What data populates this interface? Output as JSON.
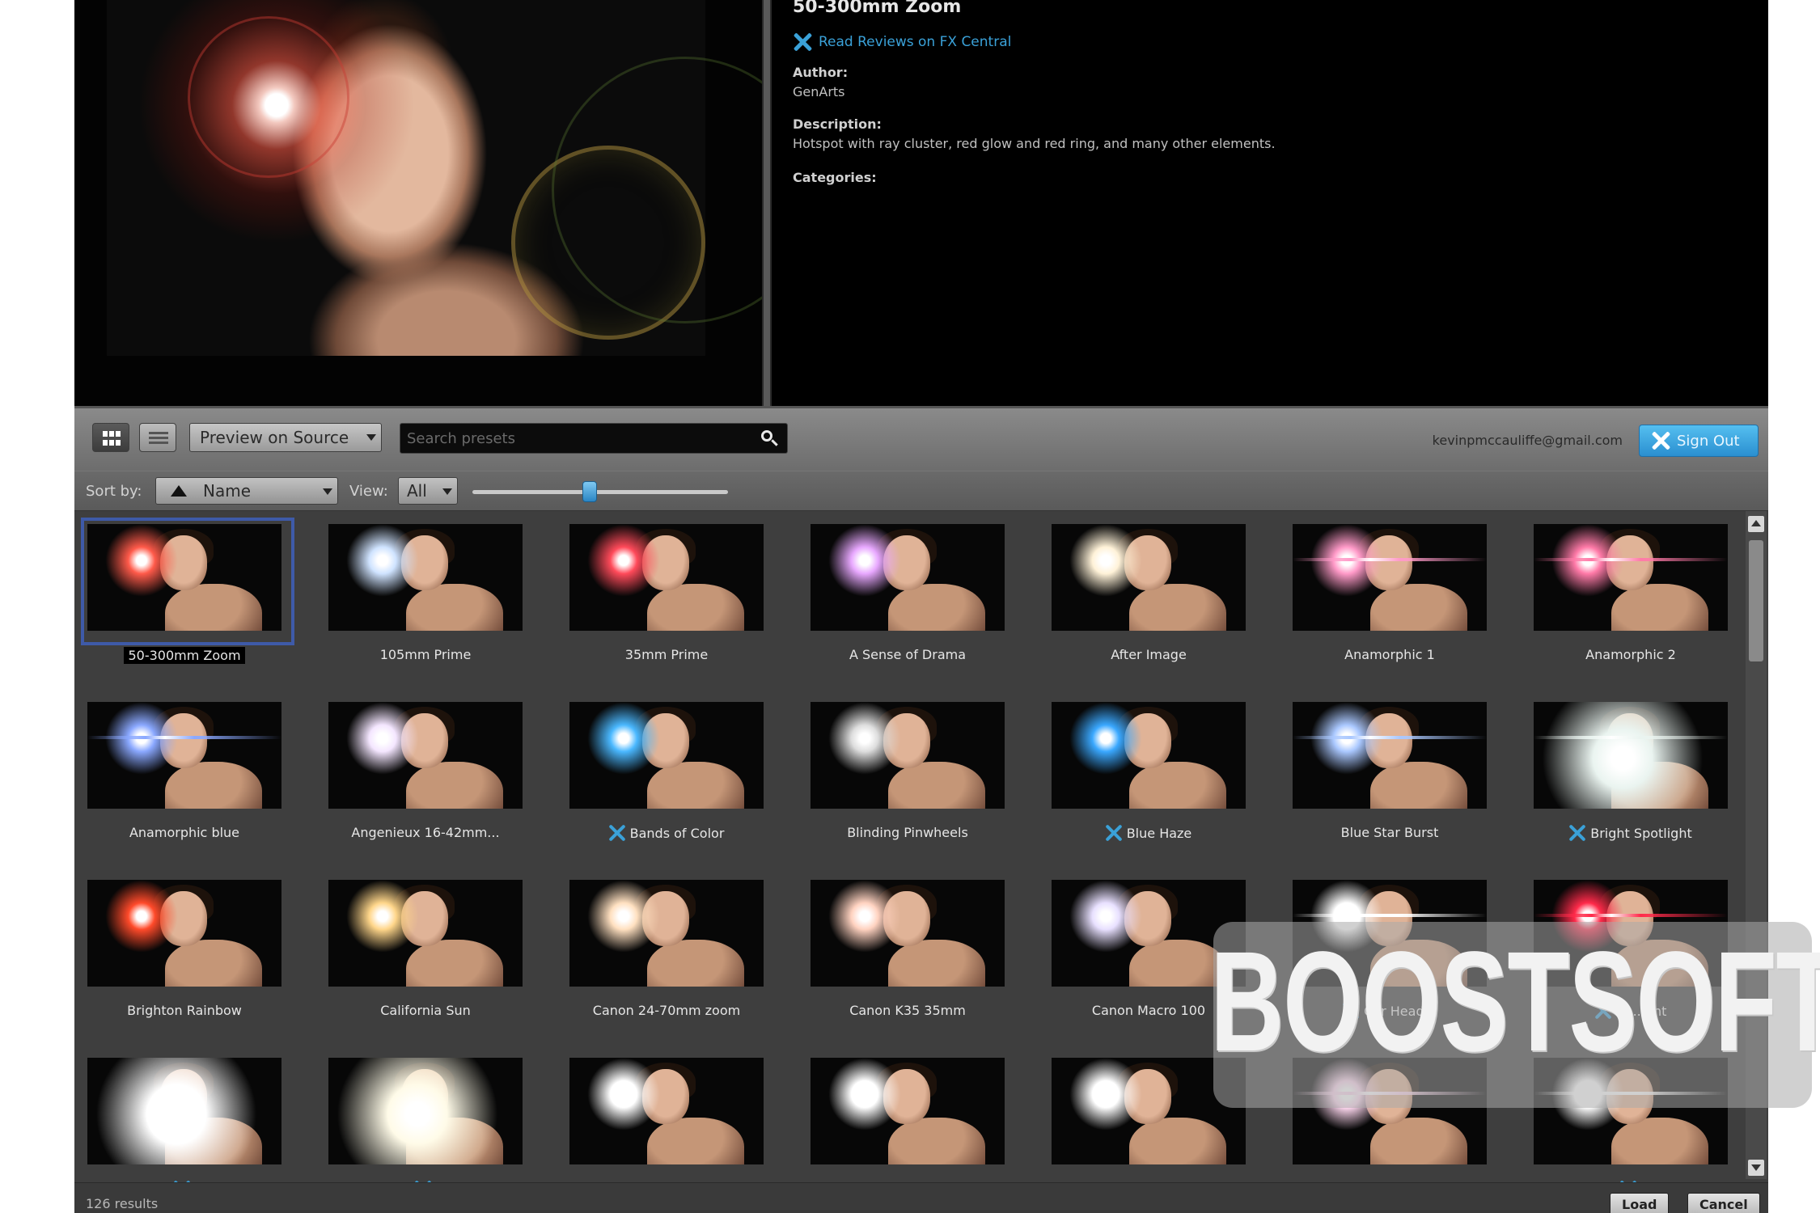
{
  "preview": {
    "title": "50-300mm Zoom",
    "reviews_link": "Read Reviews on FX Central",
    "author_label": "Author:",
    "author": "GenArts",
    "description_label": "Description:",
    "description": "Hotspot with ray cluster, red glow and red ring, and many other elements.",
    "categories_label": "Categories:"
  },
  "toolbar": {
    "grid_view_icon": "grid-view-icon",
    "list_view_icon": "list-view-icon",
    "preview_mode": "Preview on Source",
    "search_placeholder": "Search presets",
    "user_email": "kevinpmccauliffe@gmail.com",
    "sign_out": "Sign Out"
  },
  "sortbar": {
    "sort_label": "Sort by:",
    "sort_value": "Name",
    "view_label": "View:",
    "view_value": "All",
    "thumbnail_size_fraction": 0.46
  },
  "presets": [
    {
      "name": "50-300mm Zoom",
      "selected": true,
      "fx_central": false,
      "flare": "#ff5a4a"
    },
    {
      "name": "105mm Prime",
      "fx_central": false,
      "flare": "#cfe3ff"
    },
    {
      "name": "35mm Prime",
      "fx_central": false,
      "flare": "#ff4a5a"
    },
    {
      "name": "A Sense of Drama",
      "fx_central": false,
      "flare": "#e8a8ff"
    },
    {
      "name": "After Image",
      "fx_central": false,
      "flare": "#fff2d8"
    },
    {
      "name": "Anamorphic 1",
      "fx_central": false,
      "flare": "#ff9ac8"
    },
    {
      "name": "Anamorphic 2",
      "fx_central": false,
      "flare": "#ff7aa8"
    },
    {
      "name": "Anamorphic blue",
      "fx_central": false,
      "flare": "#8aa8ff"
    },
    {
      "name": "Angenieux 16-42mm...",
      "fx_central": false,
      "flare": "#f4e6ff"
    },
    {
      "name": "Bands of Color",
      "fx_central": true,
      "flare": "#4ab8ff"
    },
    {
      "name": "Blinding Pinwheels",
      "fx_central": false,
      "flare": "#dddddd"
    },
    {
      "name": "Blue Haze",
      "fx_central": true,
      "flare": "#3aa8ff"
    },
    {
      "name": "Blue Star Burst",
      "fx_central": false,
      "flare": "#aac8ff"
    },
    {
      "name": "Bright Spotlight",
      "fx_central": true,
      "flare": "#eaf4f0"
    },
    {
      "name": "Brighton Rainbow",
      "fx_central": false,
      "flare": "#ff4a2a"
    },
    {
      "name": "California Sun",
      "fx_central": false,
      "flare": "#ffd68a"
    },
    {
      "name": "Canon 24-70mm zoom",
      "fx_central": false,
      "flare": "#ffe0c0"
    },
    {
      "name": "Canon K35 35mm",
      "fx_central": false,
      "flare": "#ffd2c0"
    },
    {
      "name": "Canon Macro 100",
      "fx_central": false,
      "flare": "#e8e0ff"
    },
    {
      "name": "Car Head...",
      "fx_central": true,
      "flare": "#ffffff"
    },
    {
      "name": "Ce...ght",
      "fx_central": true,
      "flare": "#ff2a4a"
    },
    {
      "name": "",
      "fx_central": true,
      "flare": "#ffffff"
    },
    {
      "name": "",
      "fx_central": true,
      "flare": "#fffbe8"
    },
    {
      "name": "",
      "fx_central": false,
      "flare": "#ffffff"
    },
    {
      "name": "",
      "fx_central": false,
      "flare": "#ffffff"
    },
    {
      "name": "",
      "fx_central": false,
      "flare": "#ffffff"
    },
    {
      "name": "",
      "fx_central": false,
      "flare": "#ffd8f0"
    },
    {
      "name": "",
      "fx_central": true,
      "flare": "#ffffff"
    }
  ],
  "footer": {
    "results": "126 results",
    "load": "Load",
    "cancel": "Cancel"
  },
  "watermark": "BOOSTSOFT",
  "colors": {
    "accent": "#3aa1d8",
    "selection": "#3e5aa8"
  }
}
